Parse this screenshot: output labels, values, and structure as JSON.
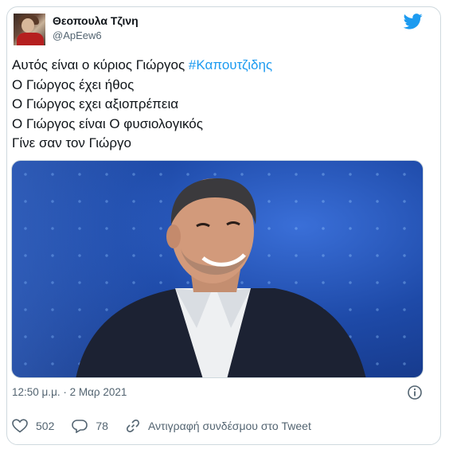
{
  "author": {
    "display_name": "Θεοπουλα Τζινη",
    "handle": "@ApEew6"
  },
  "icons": {
    "brand": "twitter-logo-icon",
    "info": "info-icon",
    "like": "heart-icon",
    "reply": "reply-bubble-icon",
    "link": "link-icon"
  },
  "colors": {
    "hashtag": "#1d9bf0",
    "twitter_blue": "#1d9bf0",
    "muted": "#536471"
  },
  "tweet": {
    "line1_text": "Αυτός είναι ο κύριος Γιώργος ",
    "line1_hashtag": "#Καπουτζιδης",
    "line2": "Ο Γιώργος έχει ήθος",
    "line3": "Ο Γιώργος εχει αξιοπρέπεια",
    "line4": "Ο Γιώργος είναι Ο φυσιολογικός",
    "line5": "Γίνε σαν τον Γιώργο"
  },
  "meta": {
    "timestamp": "12:50 μ.μ. · 2 Μαρ 2021"
  },
  "actions": {
    "likes": "502",
    "replies": "78",
    "copy_link": "Αντιγραφή συνδέσμου στο Tweet"
  }
}
